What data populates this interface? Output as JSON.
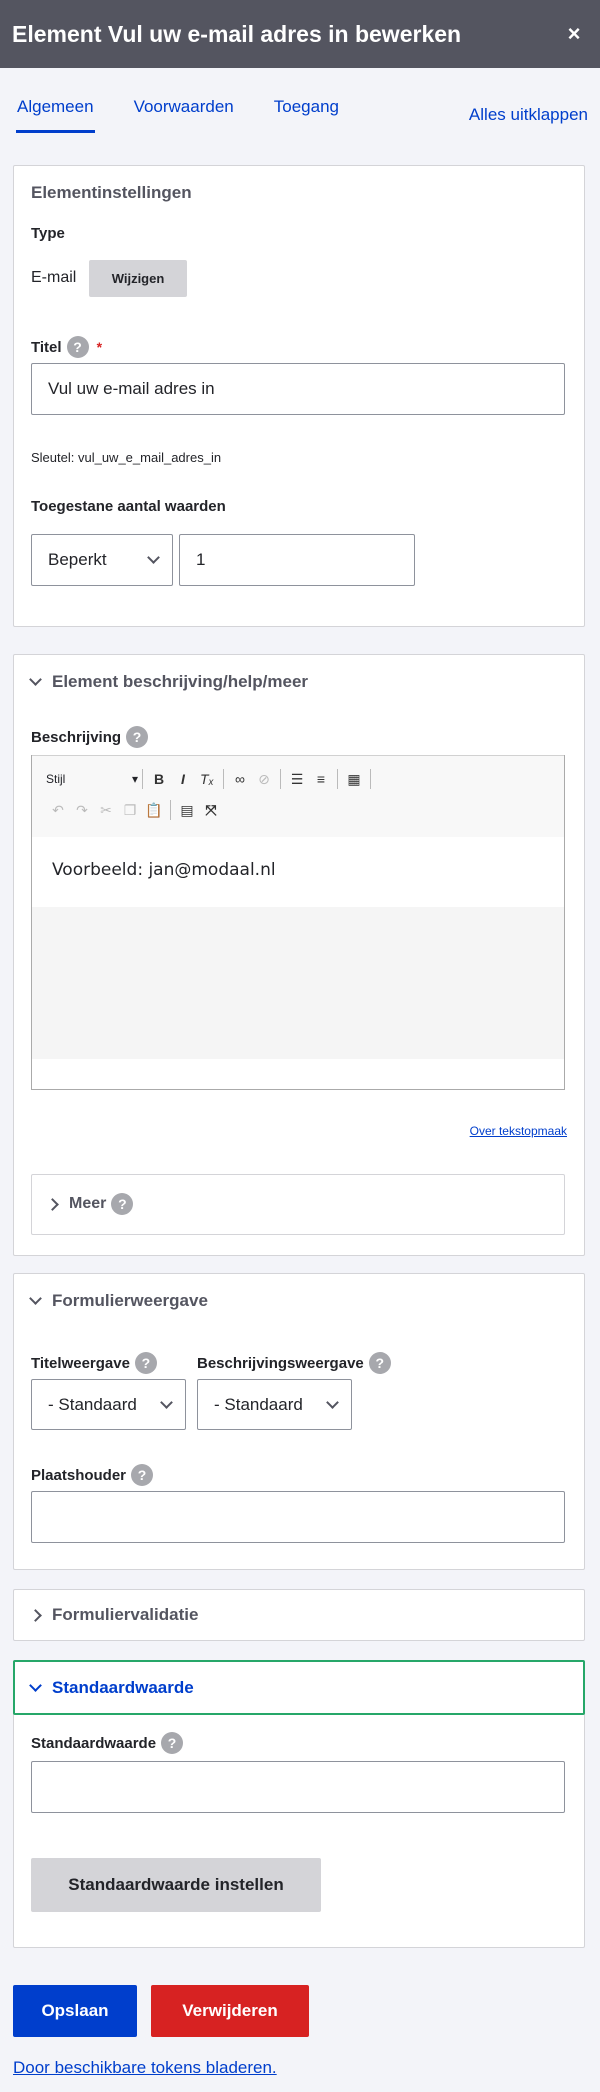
{
  "dialog": {
    "title": "Element Vul uw e-mail adres in bewerken",
    "close_glyph": "×"
  },
  "tabs": [
    {
      "label": "Algemeen",
      "active": true
    },
    {
      "label": "Voorwaarden",
      "active": false
    },
    {
      "label": "Toegang",
      "active": false
    }
  ],
  "expand_all": "Alles uitklappen",
  "settings": {
    "title": "Elementinstellingen",
    "type_label": "Type",
    "type_value": "E-mail",
    "change_button": "Wijzigen",
    "title_label": "Titel",
    "required_mark": "*",
    "title_value": "Vul uw e-mail adres in",
    "key_text": "Sleutel: vul_uw_e_mail_adres_in",
    "allowed_label": "Toegestane aantal waarden",
    "allowed_select": "Beperkt",
    "allowed_number": "1"
  },
  "description": {
    "title": "Element beschrijving/help/meer",
    "label": "Beschrijving",
    "style_select": "Stijl",
    "editor_text": "Voorbeeld: jan@modaal.nl",
    "format_link": "Over tekstopmaak",
    "more_label": "Meer"
  },
  "display": {
    "title": "Formulierweergave",
    "title_display_label": "Titelweergave",
    "title_display_value": "- Standaard",
    "desc_display_label": "Beschrijvingsweergave",
    "desc_display_value": "- Standaard",
    "placeholder_label": "Plaatshouder",
    "placeholder_value": ""
  },
  "validation": {
    "title": "Formuliervalidatie"
  },
  "default": {
    "title": "Standaardwaarde",
    "label": "Standaardwaarde",
    "value": "",
    "set_button": "Standaardwaarde instellen"
  },
  "footer": {
    "save": "Opslaan",
    "delete": "Verwijderen",
    "tokens_link": "Door beschikbare tokens bladeren."
  },
  "help_glyph": "?",
  "colors": {
    "accent": "#003ecc",
    "danger": "#d72222",
    "focus_border": "#26a769",
    "header": "#545560"
  }
}
